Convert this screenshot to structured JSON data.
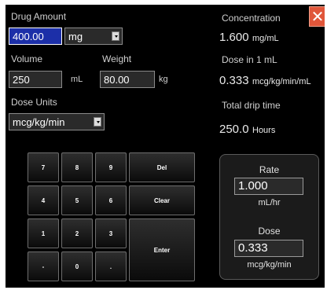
{
  "drug_amount": {
    "label": "Drug Amount",
    "value": "400.00",
    "unit": "mg"
  },
  "volume": {
    "label": "Volume",
    "value": "250",
    "unit": "mL"
  },
  "weight": {
    "label": "Weight",
    "value": "80.00",
    "unit": "kg"
  },
  "dose_units": {
    "label": "Dose Units",
    "value": "mcg/kg/min"
  },
  "concentration": {
    "label": "Concentration",
    "value": "1.600",
    "unit": "mg/mL"
  },
  "dose_in_1ml": {
    "label": "Dose in 1 mL",
    "value": "0.333",
    "unit": "mcg/kg/min/mL"
  },
  "total_drip_time": {
    "label": "Total drip time",
    "value": "250.0",
    "unit": "Hours"
  },
  "keypad": {
    "k7": "7",
    "k8": "8",
    "k9": "9",
    "del": "Del",
    "k4": "4",
    "k5": "5",
    "k6": "6",
    "clear": "Clear",
    "k1": "1",
    "k2": "2",
    "k3": "3",
    "enter": "Enter",
    "minus": "-",
    "k0": "0",
    "dot": "."
  },
  "rate_panel": {
    "rate_label": "Rate",
    "rate_value": "1.000",
    "rate_unit": "mL/hr",
    "dose_label": "Dose",
    "dose_value": "0.333",
    "dose_unit": "mcg/kg/min"
  },
  "close_glyph": "✕",
  "colors": {
    "background": "#000000",
    "selected_field": "#1c2fa8",
    "close_button": "#e0563a"
  }
}
